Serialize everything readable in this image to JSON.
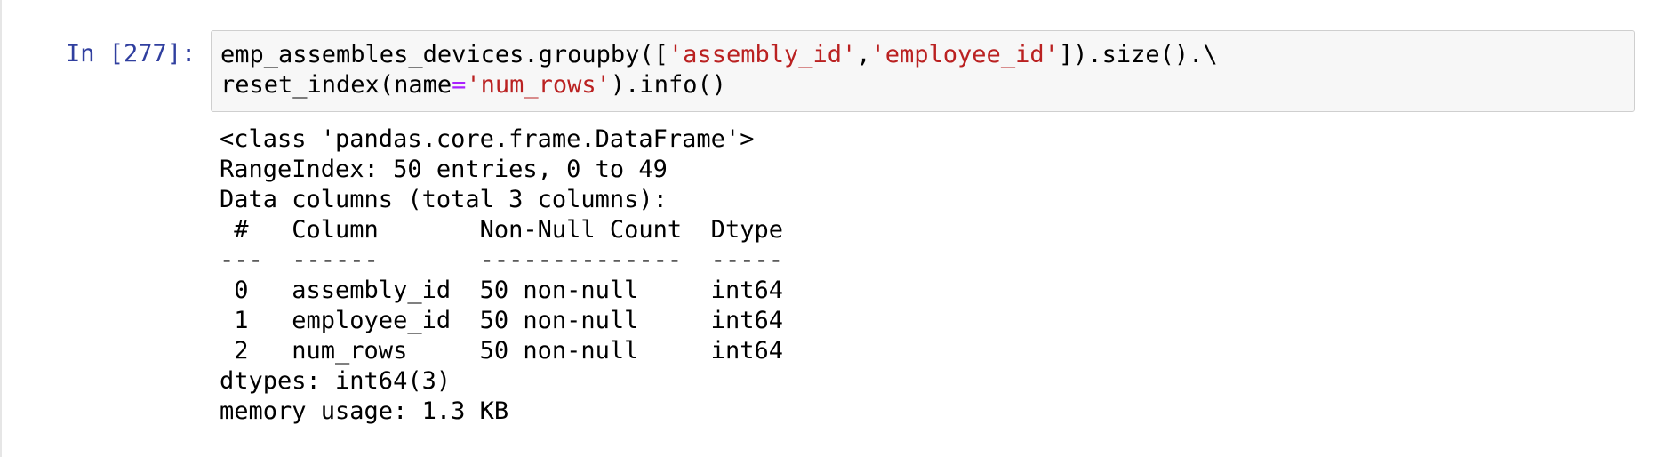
{
  "cell": {
    "prompt": "In [277]:",
    "code": {
      "line1": [
        {
          "text": "emp_assembles_devices.groupby([",
          "kind": "plain"
        },
        {
          "text": "'assembly_id'",
          "kind": "string"
        },
        {
          "text": ",",
          "kind": "plain"
        },
        {
          "text": "'employee_id'",
          "kind": "string"
        },
        {
          "text": "]).size().\\",
          "kind": "plain"
        }
      ],
      "line2": [
        {
          "text": "reset_index(name",
          "kind": "plain"
        },
        {
          "text": "=",
          "kind": "operator"
        },
        {
          "text": "'num_rows'",
          "kind": "string"
        },
        {
          "text": ").info()",
          "kind": "plain"
        }
      ]
    },
    "output_lines": [
      "<class 'pandas.core.frame.DataFrame'>",
      "RangeIndex: 50 entries, 0 to 49",
      "Data columns (total 3 columns):",
      " #   Column       Non-Null Count  Dtype",
      "---  ------       --------------  -----",
      " 0   assembly_id  50 non-null     int64",
      " 1   employee_id  50 non-null     int64",
      " 2   num_rows     50 non-null     int64",
      "dtypes: int64(3)",
      "memory usage: 1.3 KB"
    ]
  },
  "colors": {
    "prompt": "#303f9f",
    "string": "#ba2121",
    "operator": "#aa22ff",
    "code_bg": "#f7f7f7",
    "code_border": "#cfcfcf"
  }
}
